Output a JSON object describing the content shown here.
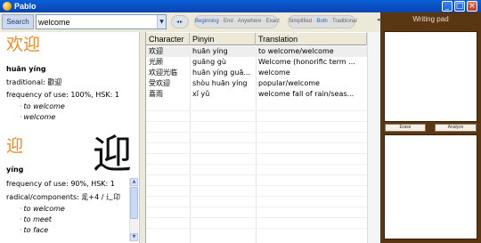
{
  "window": {
    "title": "Pablo",
    "minimize": "_",
    "maximize": "□",
    "close": "×"
  },
  "search": {
    "label": "Search",
    "value": "welcome",
    "nav": "◂▸",
    "match_modes": [
      "Beginning",
      "End",
      "Anywhere",
      "Exact"
    ],
    "script_modes": [
      "Simplified",
      "Both",
      "Traditional"
    ]
  },
  "entry1": {
    "char": "欢迎",
    "pinyin": "huān yíng",
    "traditional_label": "traditional:",
    "traditional_value": "歡迎",
    "frequency": "frequency of use: 100%, HSK: 1",
    "meanings": [
      "to welcome",
      "welcome"
    ]
  },
  "entry2": {
    "char": "迎",
    "pinyin": "yíng",
    "frequency": "frequency of use: 90%, HSK: 1",
    "radical": "radical/components: 辵+4  /  辶卬",
    "meanings": [
      "to welcome",
      "to meet",
      "to face"
    ]
  },
  "table": {
    "headers": [
      "Character",
      "Pinyin",
      "Translation"
    ],
    "rows": [
      {
        "character": "欢迎",
        "pinyin": "huān yíng",
        "translation": "to welcome/welcome"
      },
      {
        "character": "光顾",
        "pinyin": "guāng gù",
        "translation": "Welcome (honorific term ..."
      },
      {
        "character": "欢迎光临",
        "pinyin": "huān yíng guā...",
        "translation": "welcome"
      },
      {
        "character": "受欢迎",
        "pinyin": "shòu huān yíng",
        "translation": "popular/welcome"
      },
      {
        "character": "喜雨",
        "pinyin": "xǐ yǔ",
        "translation": "welcome fall of rain/seas..."
      }
    ]
  },
  "writing_pad": {
    "title": "Writing pad",
    "erase": "Erase",
    "analyze": "Analyze"
  }
}
